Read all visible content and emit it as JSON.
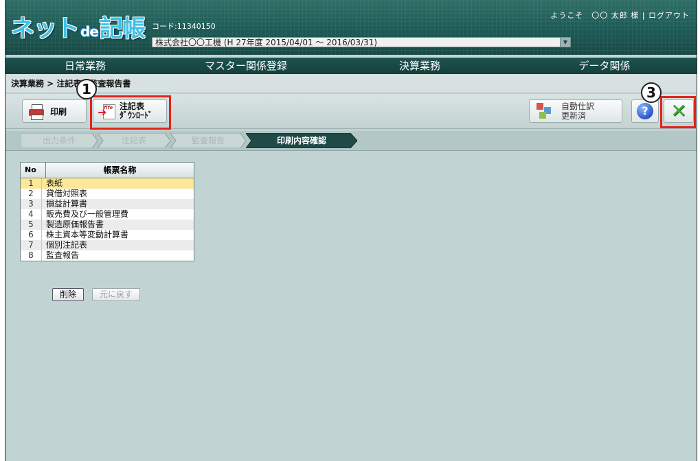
{
  "header": {
    "logo_main": "ネット",
    "logo_de": "de",
    "logo_tail": "記帳",
    "code": "コード:11340150",
    "company": "株式会社〇〇工機 (H 27年度 2015/04/01 ～ 2016/03/31)",
    "welcome": "ようこそ　〇〇 太郎 様 | ログアウト"
  },
  "menu": [
    "日常業務",
    "マスター関係登録",
    "決算業務",
    "データ関係"
  ],
  "breadcrumb": "決算業務 > 注記表・監査報告書",
  "toolbar": {
    "print_label": "印刷",
    "download_label_1": "注記表",
    "download_label_2": "ﾀﾞｳﾝﾛｰﾄﾞ",
    "auto_label_1": "自動仕訳",
    "auto_label_2": "更新済",
    "help_glyph": "?",
    "close_glyph": "✕"
  },
  "steps": [
    "出力条件",
    "注記表",
    "監査報告",
    "印刷内容確認"
  ],
  "annotations": [
    "1",
    "3"
  ],
  "table": {
    "header_no": "No",
    "header_name": "帳票名称",
    "rows": [
      {
        "no": "1",
        "name": "表紙"
      },
      {
        "no": "2",
        "name": "貸借対照表"
      },
      {
        "no": "3",
        "name": "損益計算書"
      },
      {
        "no": "4",
        "name": "販売費及び一般管理費"
      },
      {
        "no": "5",
        "name": "製造原価報告書"
      },
      {
        "no": "6",
        "name": "株主資本等変動計算書"
      },
      {
        "no": "7",
        "name": "個別注記表"
      },
      {
        "no": "8",
        "name": "監査報告"
      }
    ]
  },
  "buttons": {
    "delete": "削除",
    "restore": "元に戻す"
  },
  "colors": {
    "header": "#1e5a55",
    "annotation": "#e2231a",
    "selected_row": "#fde89a",
    "active_step": "#1f4a47"
  },
  "icons": [
    "printer-icon",
    "download-doc-icon",
    "auto-journal-icon",
    "help-icon",
    "close-icon",
    "dropdown-icon"
  ]
}
